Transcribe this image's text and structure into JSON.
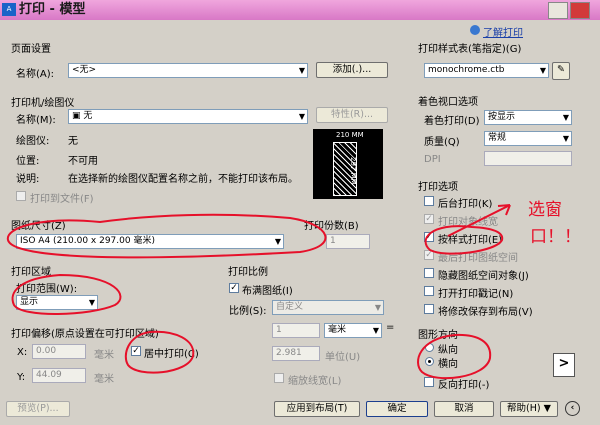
{
  "window": {
    "title": "打印 - 模型",
    "help_link": "了解打印"
  },
  "page_setup": {
    "group": "页面设置",
    "name_label": "名称(A):",
    "name_value": "<无>",
    "add_button": "添加(.)..."
  },
  "printer": {
    "group": "打印机/绘图仪",
    "name_label": "名称(M):",
    "name_value": "无",
    "properties_button": "特性(R)...",
    "plotter_label": "绘图仪:",
    "plotter_value": "无",
    "location_label": "位置:",
    "location_value": "不可用",
    "desc_label": "说明:",
    "desc_value": "在选择新的绘图仪配置名称之前，不能打印该布局。",
    "print_to_file": "打印到文件(F)",
    "preview_width": "210 MM",
    "preview_height": "297 MM"
  },
  "paper_size": {
    "group": "图纸尺寸(Z)",
    "value": "ISO A4 (210.00 x 297.00 毫米)"
  },
  "copies": {
    "label": "打印份数(B)",
    "value": "1"
  },
  "print_area": {
    "group": "打印区域",
    "range_label": "打印范围(W):",
    "range_value": "显示"
  },
  "print_scale": {
    "group": "打印比例",
    "fit_paper": "布满图纸(I)",
    "scale_label": "比例(S):",
    "scale_value": "自定义",
    "value1": "1",
    "unit1": "毫米",
    "eq": "=",
    "value2": "2.981",
    "unit2": "单位(U)",
    "scale_lineweights": "缩放线宽(L)"
  },
  "offset": {
    "group": "打印偏移(原点设置在可打印区域)",
    "x_label": "X:",
    "x_value": "0.00",
    "x_unit": "毫米",
    "y_label": "Y:",
    "y_value": "44.09",
    "y_unit": "毫米",
    "center": "居中打印(C)"
  },
  "style_table": {
    "group": "打印样式表(笔指定)(G)",
    "value": "monochrome.ctb"
  },
  "shaded": {
    "group": "着色视口选项",
    "shade_label": "着色打印(D)",
    "shade_value": "按显示",
    "quality_label": "质量(Q)",
    "quality_value": "常规",
    "dpi_label": "DPI"
  },
  "options": {
    "group": "打印选项",
    "items": [
      "后台打印(K)",
      "打印对象线宽",
      "按样式打印(E)",
      "最后打印图纸空间",
      "隐藏图纸空间对象(J)",
      "打开打印戳记(N)",
      "将修改保存到布局(V)"
    ]
  },
  "orientation": {
    "group": "图形方向",
    "portrait": "纵向",
    "landscape": "横向",
    "reverse": "反向打印(-)"
  },
  "annotation": {
    "line1": "选窗",
    "line2": "口！！"
  },
  "bottom": {
    "preview": "预览(P)...",
    "apply": "应用到布局(T)",
    "ok": "确定",
    "cancel": "取消",
    "help": "帮助(H)"
  }
}
